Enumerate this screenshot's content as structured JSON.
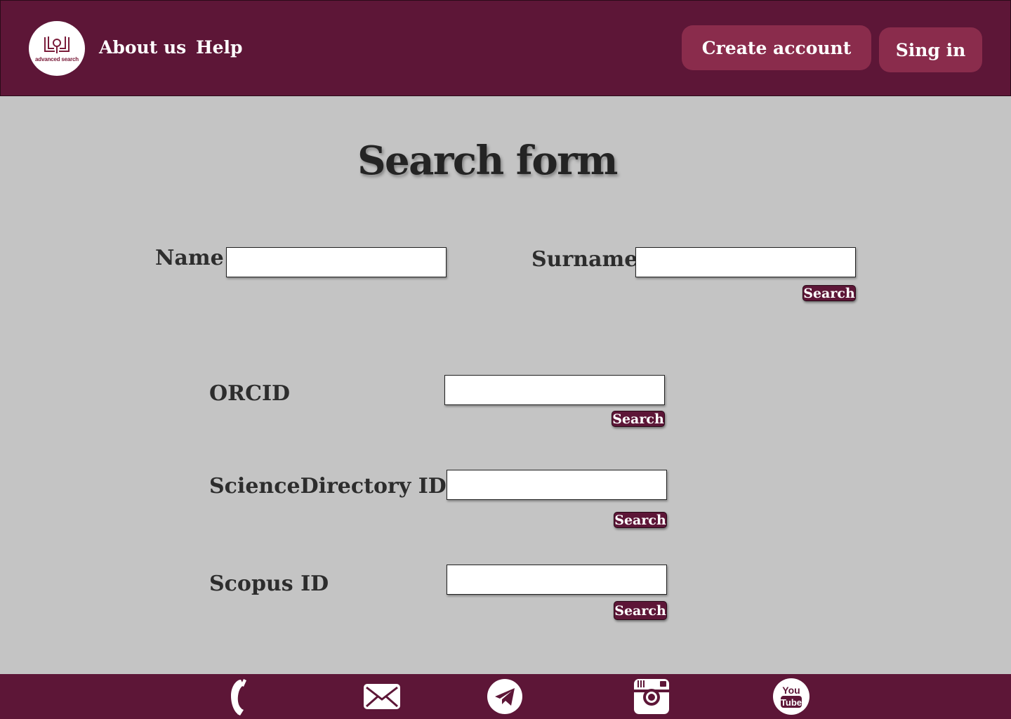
{
  "header": {
    "logo_text": "advanced search",
    "nav": [
      {
        "label": "About us"
      },
      {
        "label": "Help"
      }
    ],
    "create_account_label": "Create account",
    "sign_in_label": "Sing in"
  },
  "main": {
    "title": "Search form",
    "name_label": "Name",
    "surname_label": "Surname",
    "orcid_label": "ORCID",
    "sciencedirectory_label": "ScienceDirectory ID",
    "scopus_label": "Scopus ID",
    "search_label": "Search"
  },
  "footer": {
    "icons": [
      "phone-icon",
      "mail-icon",
      "telegram-icon",
      "instagram-icon",
      "youtube-icon"
    ]
  },
  "colors": {
    "brand": "#5d1637",
    "button": "#8a2c4c",
    "background": "#c4c4c4"
  }
}
